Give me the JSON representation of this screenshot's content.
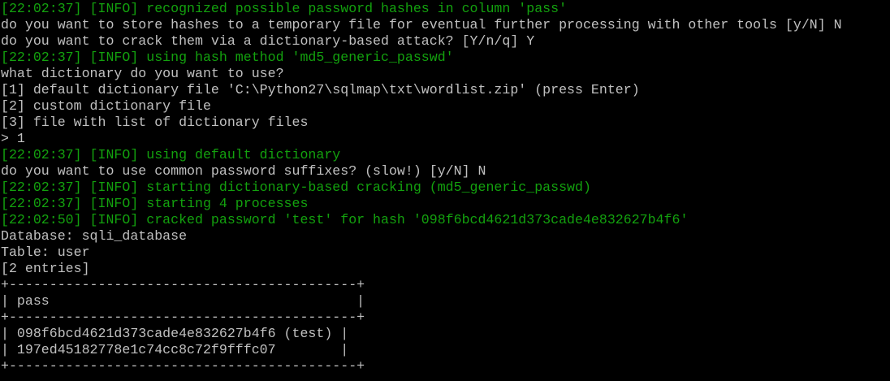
{
  "colors": {
    "background": "#000000",
    "default_text": "#c0c0c0",
    "info_text": "#13a10e"
  },
  "terminal": {
    "lines": [
      {
        "text": "[22:02:37] [INFO] recognized possible password hashes in column 'pass'",
        "kind": "info"
      },
      {
        "text": "do you want to store hashes to a temporary file for eventual further processing with other tools [y/N] N",
        "kind": "plain"
      },
      {
        "text": "do you want to crack them via a dictionary-based attack? [Y/n/q] Y",
        "kind": "plain"
      },
      {
        "text": "[22:02:37] [INFO] using hash method 'md5_generic_passwd'",
        "kind": "info"
      },
      {
        "text": "what dictionary do you want to use?",
        "kind": "plain"
      },
      {
        "text": "[1] default dictionary file 'C:\\Python27\\sqlmap\\txt\\wordlist.zip' (press Enter)",
        "kind": "plain"
      },
      {
        "text": "[2] custom dictionary file",
        "kind": "plain"
      },
      {
        "text": "[3] file with list of dictionary files",
        "kind": "plain"
      },
      {
        "text": "> 1",
        "kind": "plain"
      },
      {
        "text": "[22:02:37] [INFO] using default dictionary",
        "kind": "info"
      },
      {
        "text": "do you want to use common password suffixes? (slow!) [y/N] N",
        "kind": "plain"
      },
      {
        "text": "[22:02:37] [INFO] starting dictionary-based cracking (md5_generic_passwd)",
        "kind": "info"
      },
      {
        "text": "[22:02:37] [INFO] starting 4 processes",
        "kind": "info"
      },
      {
        "text": "[22:02:50] [INFO] cracked password 'test' for hash '098f6bcd4621d373cade4e832627b4f6'",
        "kind": "info"
      },
      {
        "text": "Database: sqli_database",
        "kind": "plain"
      },
      {
        "text": "Table: user",
        "kind": "plain"
      },
      {
        "text": "[2 entries]",
        "kind": "plain"
      },
      {
        "text": "+-------------------------------------------+",
        "kind": "plain"
      },
      {
        "text": "| pass                                      |",
        "kind": "plain"
      },
      {
        "text": "+-------------------------------------------+",
        "kind": "plain"
      },
      {
        "text": "| 098f6bcd4621d373cade4e832627b4f6 (test) |",
        "kind": "plain"
      },
      {
        "text": "| 197ed45182778e1c74cc8c72f9fffc07        |",
        "kind": "plain"
      },
      {
        "text": "+-------------------------------------------+",
        "kind": "plain"
      }
    ]
  }
}
